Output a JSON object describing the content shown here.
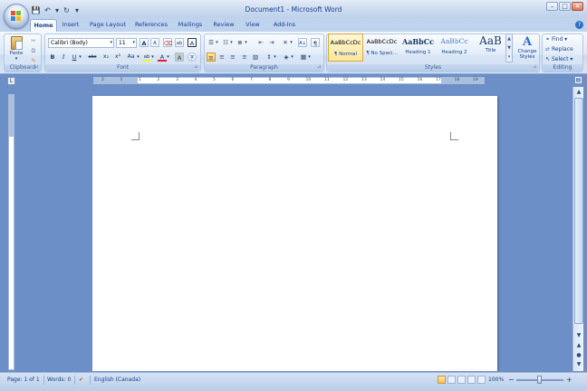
{
  "window": {
    "title": "Document1 - Microsoft Word",
    "controls": {
      "minimize": "–",
      "maximize": "□",
      "close": "✕"
    }
  },
  "qat": {
    "save": "💾",
    "undo": "↶",
    "undo_drop": "▾",
    "redo": "↻",
    "customize": "▾"
  },
  "tabs": [
    "Home",
    "Insert",
    "Page Layout",
    "References",
    "Mailings",
    "Review",
    "View",
    "Add-Ins"
  ],
  "active_tab": "Home",
  "help": "?",
  "clipboard": {
    "label": "Clipboard",
    "paste": "Paste",
    "launcher": "⊿"
  },
  "font": {
    "label": "Font",
    "family": "Calibri (Body)",
    "size": "11",
    "grow": "A",
    "shrink": "A",
    "clear": "⌫",
    "phonetic": "ab",
    "border": "A",
    "bold": "B",
    "italic": "I",
    "underline": "U",
    "strike": "abc",
    "subscript": "x₂",
    "superscript": "x²",
    "case": "Aa",
    "highlight": "ab",
    "color": "A",
    "char_shading": "A",
    "enclose": "字",
    "launcher": "⊿"
  },
  "paragraph": {
    "label": "Paragraph",
    "bullets": "☰",
    "numbering": "☷",
    "multilevel": "≣",
    "decrease": "⇤",
    "increase": "⇥",
    "asian": "✕",
    "sort": "A↓",
    "pilcrow": "¶",
    "align_left": "≡",
    "center": "≡",
    "align_right": "≡",
    "justify": "≡",
    "distribute": "▥",
    "line_spacing": "↕",
    "shading": "◈",
    "borders": "▦",
    "launcher": "⊿"
  },
  "styles": {
    "label": "Styles",
    "items": [
      {
        "sample": "AaBbCcDc",
        "name": "¶ Normal"
      },
      {
        "sample": "AaBbCcDc",
        "name": "¶ No Spaci..."
      },
      {
        "sample": "AaBbCc",
        "name": "Heading 1"
      },
      {
        "sample": "AaBbCc",
        "name": "Heading 2"
      },
      {
        "sample": "AaB",
        "name": "Title"
      }
    ],
    "change_styles": "Change Styles",
    "change_icon": "A",
    "launcher": "⊿"
  },
  "editing": {
    "label": "Editing",
    "find": "Find",
    "replace": "Replace",
    "select": "Select"
  },
  "ruler": {
    "ticks": [
      "2",
      "1",
      "1",
      "2",
      "3",
      "4",
      "5",
      "6",
      "7",
      "8",
      "9",
      "10",
      "11",
      "12",
      "13",
      "14",
      "15",
      "16",
      "17",
      "18",
      "19"
    ],
    "tab_selector": "L",
    "view_ruler": "▤"
  },
  "status": {
    "page": "Page: 1 of 1",
    "words": "Words: 0",
    "language": "English (Canada)",
    "zoom": "100%",
    "zoom_out": "−",
    "zoom_in": "+"
  },
  "scrollbar": {
    "up": "▲",
    "down": "▼",
    "prev": "▲",
    "select": "●",
    "next": "▼"
  }
}
